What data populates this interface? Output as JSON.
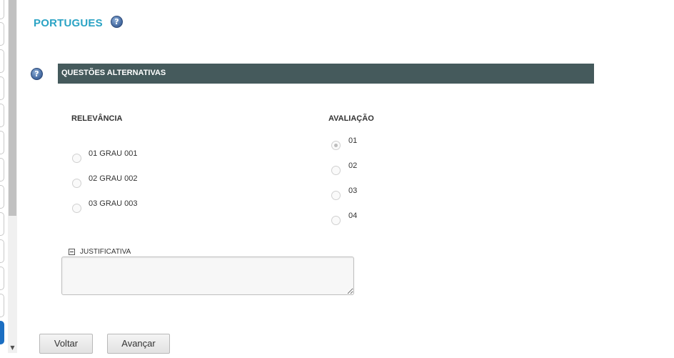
{
  "page": {
    "title": "PORTUGUES"
  },
  "section": {
    "title": "QUESTÕES ALTERNATIVAS"
  },
  "relevance": {
    "header": "RELEVÂNCIA",
    "options": [
      {
        "label": "01 GRAU 001",
        "selected": false
      },
      {
        "label": "02 GRAU 002",
        "selected": false
      },
      {
        "label": "03 GRAU 003",
        "selected": false
      }
    ]
  },
  "evaluation": {
    "header": "AVALIAÇÃO",
    "options": [
      {
        "label": "01",
        "selected": true
      },
      {
        "label": "02",
        "selected": false
      },
      {
        "label": "03",
        "selected": false
      },
      {
        "label": "04",
        "selected": false
      }
    ]
  },
  "justification": {
    "label": "JUSTIFICATIVA",
    "value": ""
  },
  "buttons": {
    "back": "Voltar",
    "next": "Avançar"
  },
  "icons": {
    "help": "?"
  }
}
